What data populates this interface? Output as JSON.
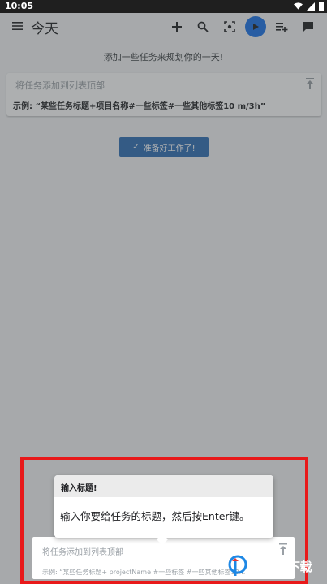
{
  "status_bar": {
    "time": "10:05"
  },
  "app_bar": {
    "title": "今天"
  },
  "hint_text": "添加一些任务来规划你的一天!",
  "top_task_input": {
    "placeholder": "将任务添加到列表顶部",
    "example": "示例: “某些任务标题+项目名称#一些标签#一些其他标签10 m/3h”"
  },
  "ready_button": {
    "label": "准备好工作了!"
  },
  "tooltip": {
    "title": "输入标题!",
    "body": "输入你要给任务的标题，然后按Enter键。"
  },
  "bottom_task_input": {
    "placeholder": "将任务添加到列表顶部",
    "example": "示例: “某些任务标题+ projectName #一些标签 #一些其他标签10..."
  },
  "watermark": {
    "brand": "PCPOP下载"
  },
  "colors": {
    "accent": "#1a73e8",
    "highlight_border": "#e8191a",
    "ready_button": "#2f6fb6"
  }
}
